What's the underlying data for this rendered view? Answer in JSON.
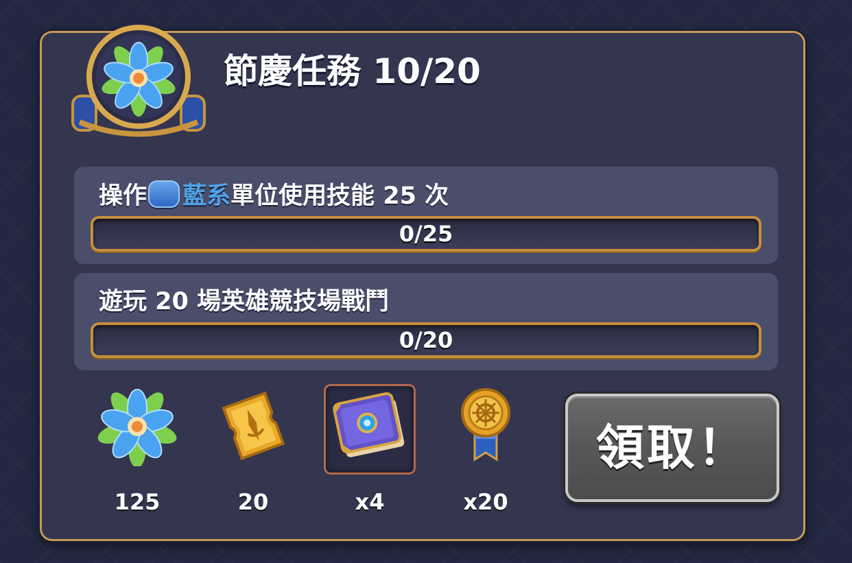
{
  "header": {
    "title": "節慶任務 10/20",
    "icon": "festival-flower-emblem-icon"
  },
  "quests": [
    {
      "text_before": "操作",
      "icon": "blue-faction-icon",
      "highlight": "藍系",
      "text_after": "單位使用技能 25 次",
      "progress_text": "0/25",
      "progress": 0
    },
    {
      "text": "遊玩 20 場英雄競技場戰鬥",
      "progress_text": "0/20",
      "progress": 0
    }
  ],
  "rewards": [
    {
      "icon": "blue-flower-icon",
      "count": "125"
    },
    {
      "icon": "gold-ticket-icon",
      "count": "20"
    },
    {
      "icon": "spell-book-icon",
      "count": "x4"
    },
    {
      "icon": "gold-medal-icon",
      "count": "x20"
    }
  ],
  "claim_button": {
    "label": "領取！"
  },
  "colors": {
    "panel_border": "#c49a54",
    "highlight_blue": "#4fa3e8",
    "bar_border": "#c58f3f"
  }
}
